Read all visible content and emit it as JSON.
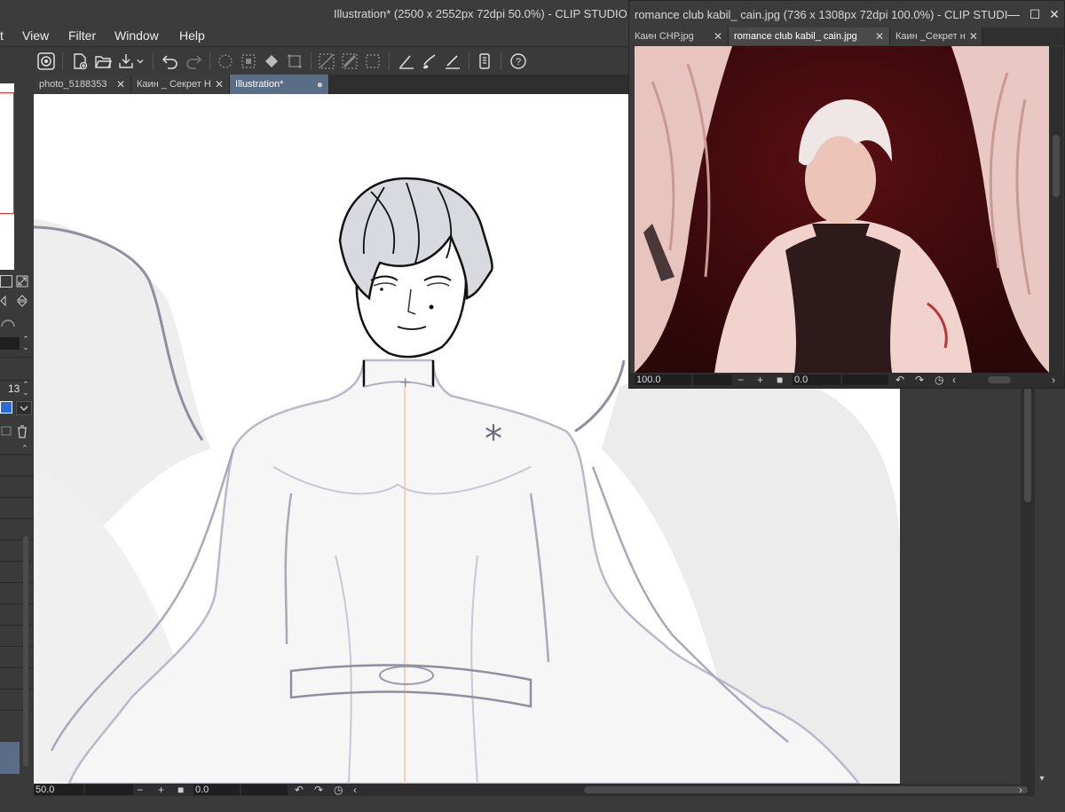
{
  "main_window": {
    "title": "Illustration* (2500 x 2552px 72dpi 50.0%)  - CLIP STUDIO"
  },
  "menu": {
    "items": [
      {
        "label": "t"
      },
      {
        "label": "View"
      },
      {
        "label": "Filter"
      },
      {
        "label": "Window"
      },
      {
        "label": "Help"
      }
    ]
  },
  "toolbar": {
    "icons": [
      "clip-studio-icon",
      "new-file-icon",
      "open-folder-icon",
      "save-icon",
      "undo-icon",
      "redo-icon",
      "selection-icon",
      "fill-icon",
      "transform-icon",
      "ruler-icon",
      "guide-icon",
      "brush-icon",
      "pen-icon",
      "tablet-icon",
      "help-icon"
    ]
  },
  "doc_tabs": [
    {
      "label": "photo_5188353",
      "active": false
    },
    {
      "label": "Каин _ Секрет Н",
      "active": false
    },
    {
      "label": "Illustration*",
      "active": true
    }
  ],
  "left_dock": {
    "brush_size": "13"
  },
  "status_bar": {
    "zoom": "50.0",
    "rotation": "0.0"
  },
  "sub_window": {
    "title": "romance club kabil_ cain.jpg (736 x 1308px 72dpi 100.0%) - CLIP STUDIO",
    "tabs": [
      {
        "label": "Каин СНР.jpg",
        "active": false
      },
      {
        "label": "romance club kabil_ cain.jpg",
        "active": true
      },
      {
        "label": "Каин _Секрет н",
        "active": false
      }
    ],
    "zoom": "100.0",
    "rotation": "0.0"
  },
  "colors": {
    "accent_tab": "#5a6d86",
    "ui_bg": "#3a3a3a",
    "field_bg": "#1f1f1f"
  }
}
